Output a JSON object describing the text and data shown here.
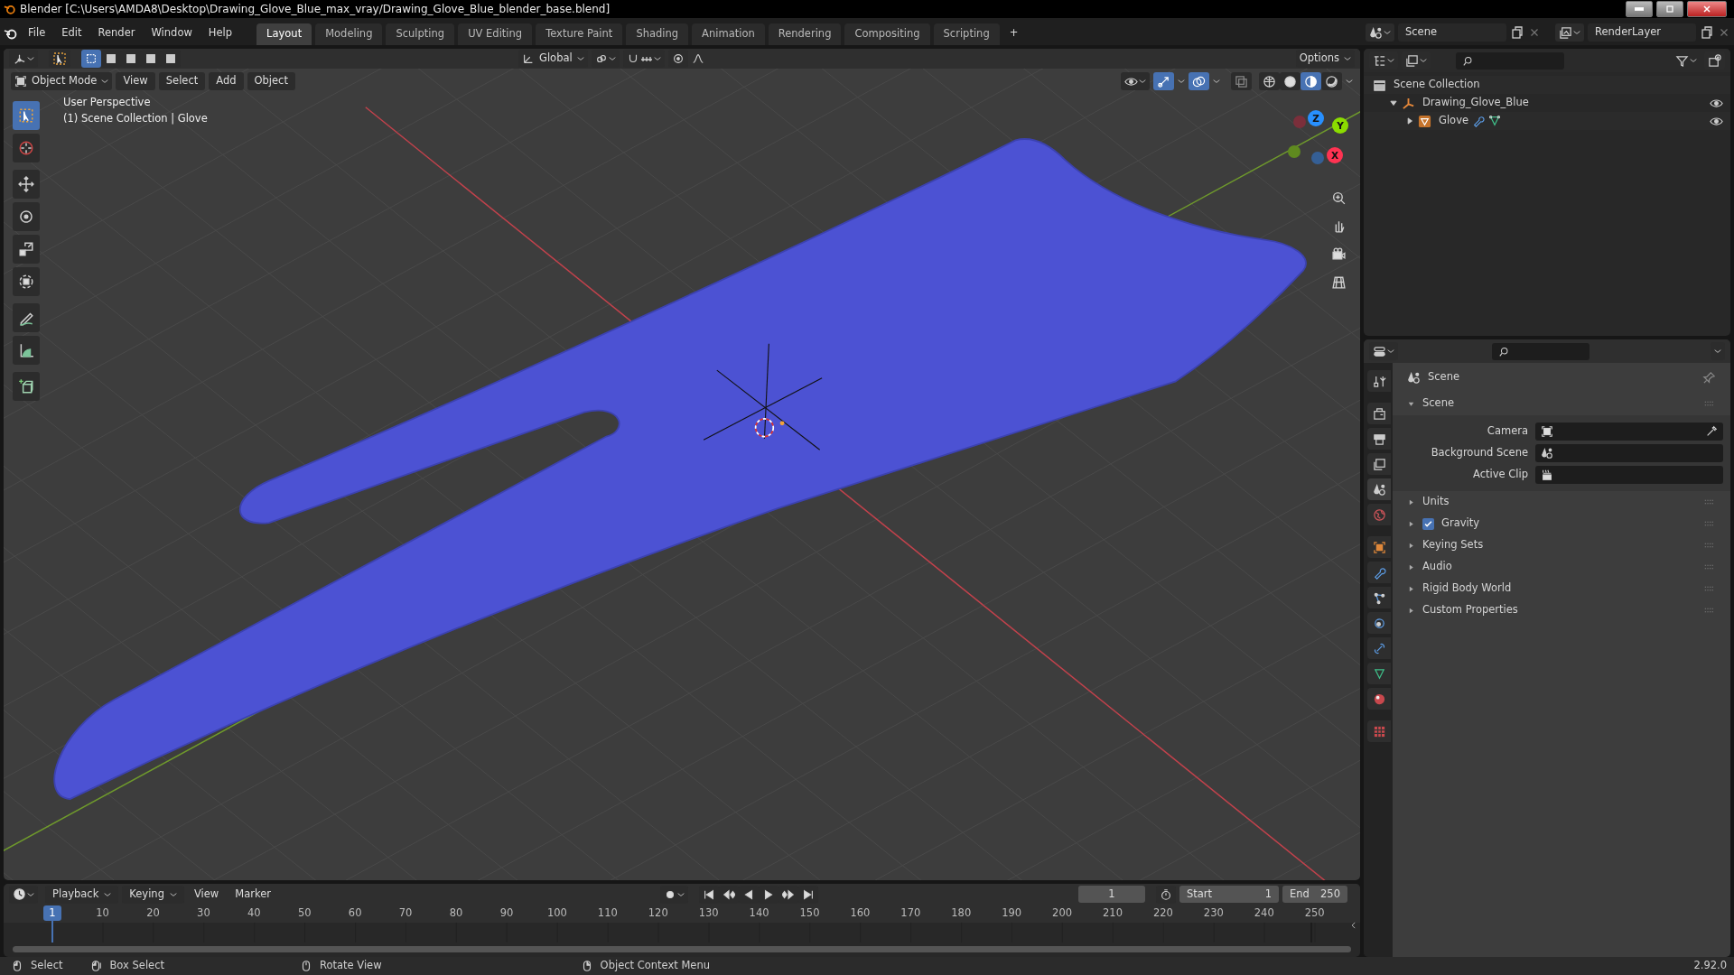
{
  "window": {
    "title": "Blender [C:\\Users\\AMDA8\\Desktop\\Drawing_Glove_Blue_max_vray/Drawing_Glove_Blue_blender_base.blend]"
  },
  "menu": [
    "File",
    "Edit",
    "Render",
    "Window",
    "Help"
  ],
  "workspaces": [
    {
      "label": "Layout",
      "selected": true
    },
    {
      "label": "Modeling",
      "selected": false
    },
    {
      "label": "Sculpting",
      "selected": false
    },
    {
      "label": "UV Editing",
      "selected": false
    },
    {
      "label": "Texture Paint",
      "selected": false
    },
    {
      "label": "Shading",
      "selected": false
    },
    {
      "label": "Animation",
      "selected": false
    },
    {
      "label": "Rendering",
      "selected": false
    },
    {
      "label": "Compositing",
      "selected": false
    },
    {
      "label": "Scripting",
      "selected": false
    }
  ],
  "add_workspace": "+",
  "scene": {
    "value": "Scene"
  },
  "view_layer": {
    "value": "RenderLayer"
  },
  "viewport": {
    "select_modes": [
      {
        "selected": true
      },
      {
        "selected": false
      },
      {
        "selected": false
      },
      {
        "selected": false
      },
      {
        "selected": false
      }
    ],
    "orientation": "Global",
    "options": "Options",
    "mode": "Object Mode",
    "menus": [
      "View",
      "Select",
      "Add",
      "Object"
    ],
    "shading_modes": [
      {
        "selected": false
      },
      {
        "selected": false
      },
      {
        "selected": true
      },
      {
        "selected": false
      }
    ],
    "info": [
      "User Perspective",
      "(1) Scene Collection | Glove"
    ],
    "toolbar": [
      {
        "selected": true
      },
      {
        "selected": false
      },
      {
        "selected": false
      },
      {
        "selected": false
      },
      {
        "selected": false
      },
      {
        "selected": false
      },
      {
        "selected": false
      },
      {
        "selected": false
      },
      {
        "selected": false
      }
    ],
    "gizmo": [
      {
        "label": "Z",
        "color": "#2890ff"
      },
      {
        "label": "Y",
        "color": "#8bdc00"
      },
      {
        "label": "X",
        "color": "#ff3352"
      }
    ]
  },
  "outliner": {
    "items": [
      {
        "label": "Scene Collection",
        "children": [
          {
            "label": "Drawing_Glove_Blue",
            "expanded": true,
            "children": [
              {
                "label": "Glove",
                "expanded": false
              }
            ]
          }
        ]
      }
    ]
  },
  "properties": {
    "tabs": [
      {
        "selected": false
      },
      {
        "selected": false
      },
      {
        "selected": false
      },
      {
        "selected": false
      },
      {
        "selected": true
      },
      {
        "selected": false
      },
      {
        "selected": false
      },
      {
        "selected": false
      },
      {
        "selected": false
      },
      {
        "selected": false
      },
      {
        "selected": false
      },
      {
        "selected": false
      },
      {
        "selected": false
      },
      {
        "selected": false
      }
    ],
    "context": "Scene",
    "panel": {
      "title": "Scene",
      "expanded": true,
      "fields": [
        {
          "label": "Camera"
        },
        {
          "label": "Background Scene"
        },
        {
          "label": "Active Clip"
        }
      ]
    },
    "subpanels": [
      {
        "title": "Units",
        "expanded": false
      },
      {
        "title": "Gravity",
        "expanded": false,
        "checkbox": {
          "checked": true
        }
      },
      {
        "title": "Keying Sets",
        "expanded": false
      },
      {
        "title": "Audio",
        "expanded": false
      },
      {
        "title": "Rigid Body World",
        "expanded": false
      },
      {
        "title": "Custom Properties",
        "expanded": false
      }
    ]
  },
  "timeline": {
    "menus": [
      {
        "label": "Playback",
        "kind": "dropdown"
      },
      {
        "label": "Keying",
        "kind": "dropdown"
      },
      {
        "label": "View",
        "kind": "menu"
      },
      {
        "label": "Marker",
        "kind": "menu"
      }
    ],
    "current_frame": "1",
    "start": {
      "label": "Start",
      "value": "1"
    },
    "end": {
      "label": "End",
      "value": "250"
    },
    "playhead": "1",
    "ruler": [
      "10",
      "20",
      "30",
      "40",
      "50",
      "60",
      "70",
      "80",
      "90",
      "100",
      "110",
      "120",
      "130",
      "140",
      "150",
      "160",
      "170",
      "180",
      "190",
      "200",
      "210",
      "220",
      "230",
      "240",
      "250"
    ]
  },
  "status_bar": {
    "hints": [
      "Select",
      "Box Select",
      "Rotate View",
      "Object Context Menu"
    ],
    "version": "2.92.0"
  }
}
